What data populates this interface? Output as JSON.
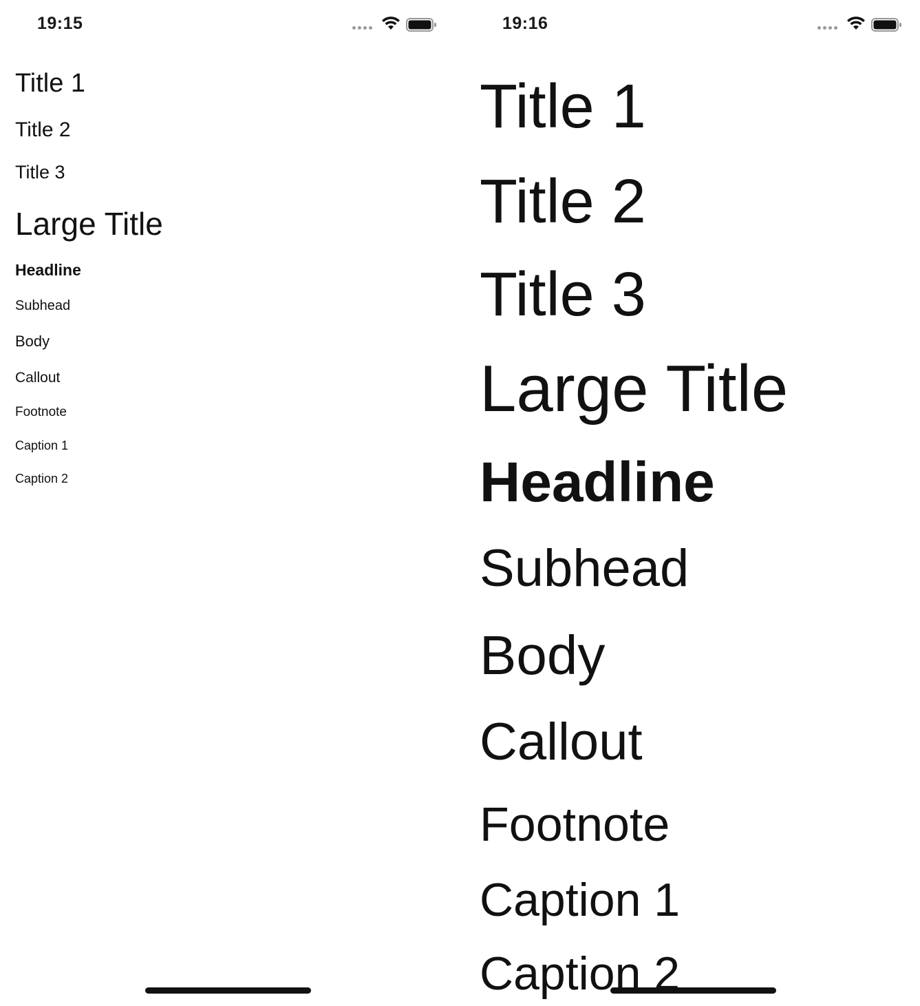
{
  "screens": [
    {
      "status_bar": {
        "time": "19:15",
        "icons": [
          "signal-dots-icon",
          "wifi-icon",
          "battery-icon"
        ]
      },
      "text_styles": [
        "Title 1",
        "Title 2",
        "Title 3",
        "Large Title",
        "Headline",
        "Subhead",
        "Body",
        "Callout",
        "Footnote",
        "Caption 1",
        "Caption 2"
      ]
    },
    {
      "status_bar": {
        "time": "19:16",
        "icons": [
          "signal-dots-icon",
          "wifi-icon",
          "battery-icon"
        ]
      },
      "text_styles": [
        "Title 1",
        "Title 2",
        "Title 3",
        "Large Title",
        "Headline",
        "Subhead",
        "Body",
        "Callout",
        "Footnote",
        "Caption 1",
        "Caption 2"
      ]
    }
  ],
  "colors": {
    "text": "#111111",
    "background": "#ffffff",
    "signal_dots": "#9a9a9a"
  }
}
